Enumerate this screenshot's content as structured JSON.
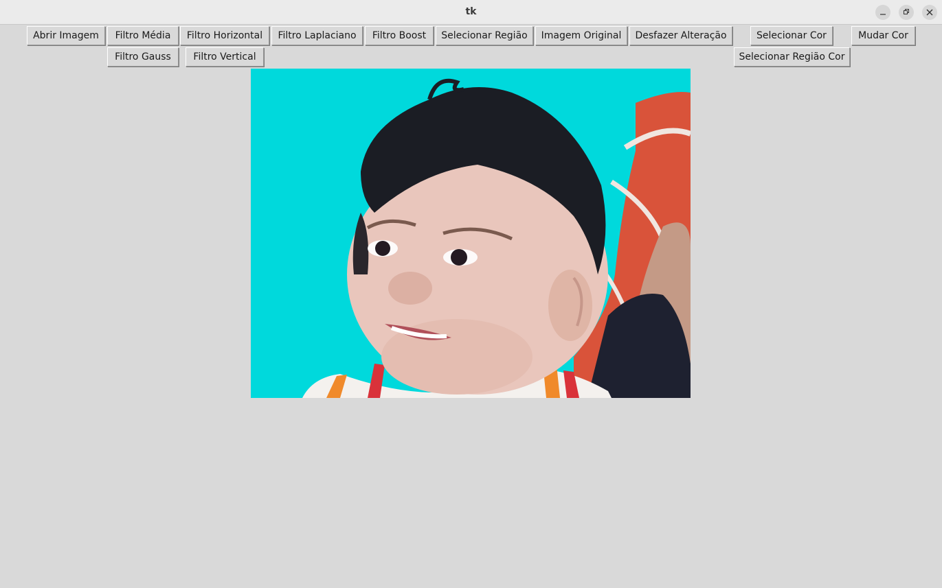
{
  "window": {
    "title": "tk"
  },
  "toolbar": {
    "row1": [
      {
        "label": "Abrir Imagem"
      },
      {
        "label": "Filtro Média"
      },
      {
        "label": "Filtro Horizontal"
      },
      {
        "label": "Filtro Laplaciano"
      },
      {
        "label": "Filtro Boost"
      },
      {
        "label": "Selecionar Região"
      },
      {
        "label": "Imagem Original"
      },
      {
        "label": "Desfazer Alteração"
      },
      {
        "label": "Selecionar Cor"
      },
      {
        "label": "Mudar Cor"
      }
    ],
    "row2": [
      {
        "label": "Filtro Gauss"
      },
      {
        "label": "Filtro Vertical"
      },
      {
        "label": "Selecionar Região Cor"
      }
    ]
  },
  "canvas": {
    "background_color": "#00d9dc",
    "image_subject": "baby-photo"
  }
}
